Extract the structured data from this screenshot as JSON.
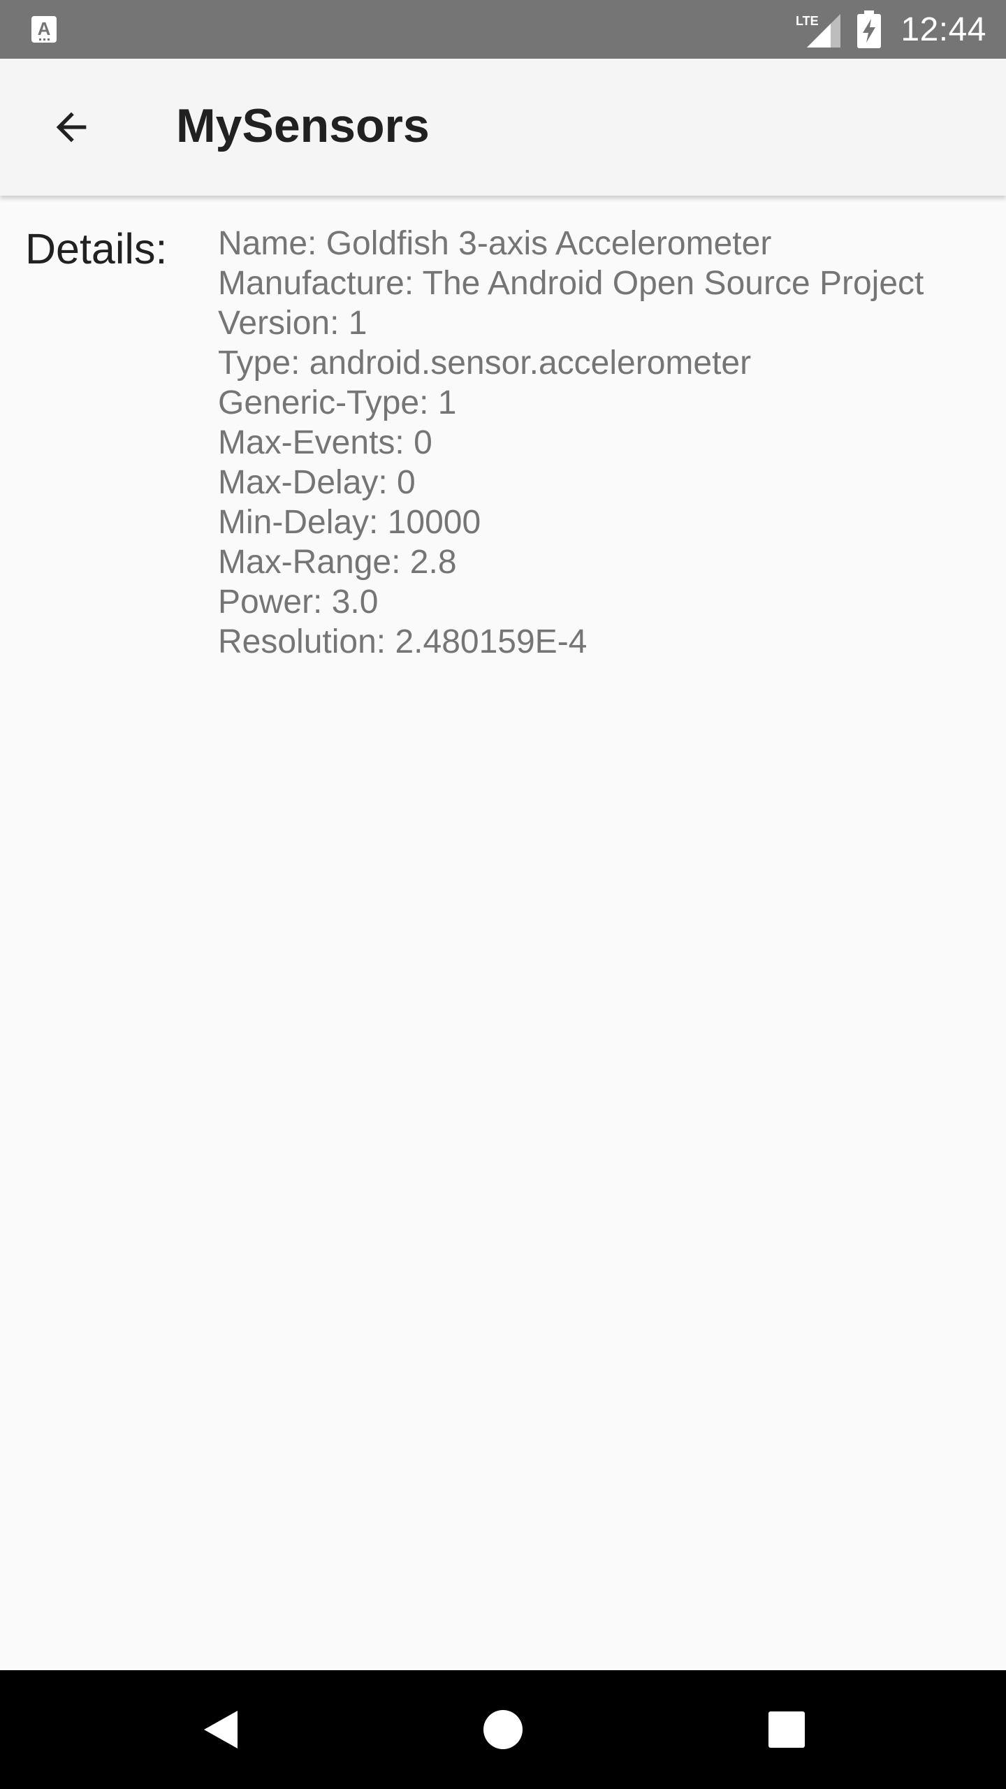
{
  "status_bar": {
    "time": "12:44",
    "network_label": "LTE",
    "left_icon": "text-a-notification-icon",
    "signal_icon": "lte-signal-icon",
    "battery_icon": "battery-charging-icon",
    "background_color": "#757575"
  },
  "app_bar": {
    "title": "MySensors",
    "back_icon": "arrow-back-icon",
    "background_color": "#f5f5f5"
  },
  "details": {
    "label": "Details:",
    "lines": [
      "Name: Goldfish 3-axis Accelerometer",
      "Manufacture: The Android Open Source Project",
      "Version: 1",
      "Type: android.sensor.accelerometer",
      "Generic-Type: 1",
      "Max-Events: 0",
      "Max-Delay: 0",
      "Min-Delay: 10000",
      "Max-Range: 2.8",
      "Power: 3.0",
      "Resolution: 2.480159E-4"
    ],
    "value_color": "#757575"
  },
  "nav_bar": {
    "back_icon": "nav-back-triangle-icon",
    "home_icon": "nav-home-circle-icon",
    "recents_icon": "nav-recents-square-icon",
    "background_color": "#000000"
  }
}
